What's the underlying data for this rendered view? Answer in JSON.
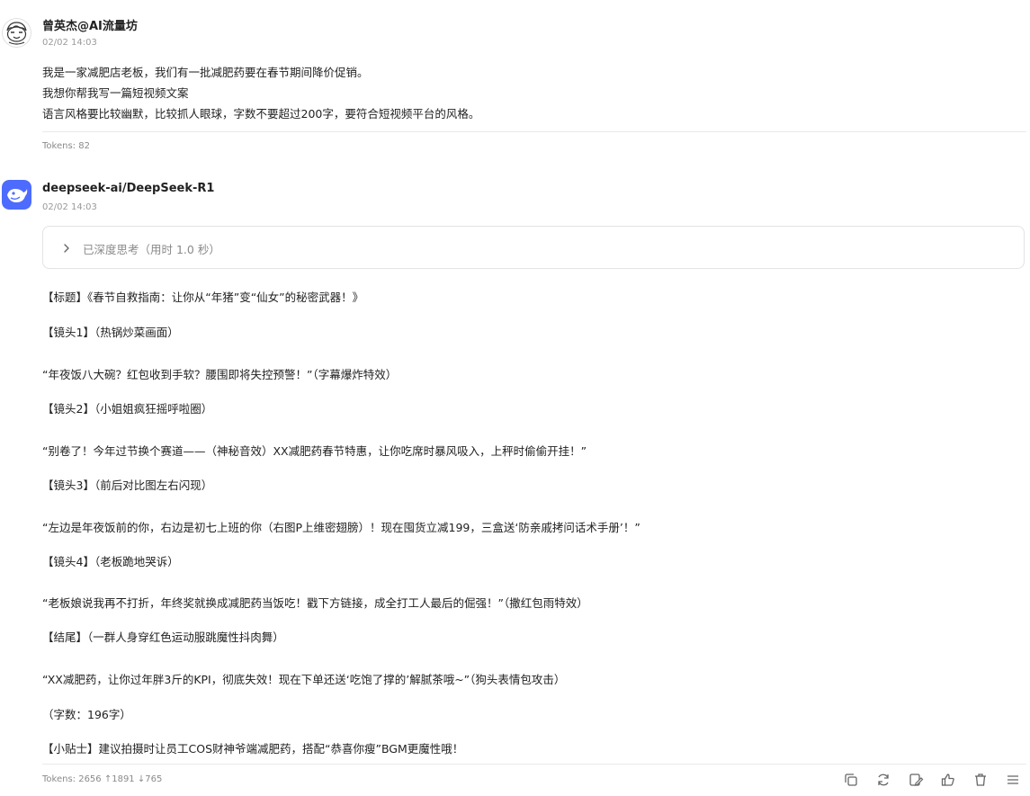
{
  "user_message": {
    "sender": "曾英杰@AI流量坊",
    "timestamp": "02/02 14:03",
    "lines": [
      "我是一家减肥店老板，我们有一批减肥药要在春节期间降价促销。",
      "我想你帮我写一篇短视频文案",
      "语言风格要比较幽默，比较抓人眼球，字数不要超过200字，要符合短视频平台的风格。"
    ],
    "tokens": "Tokens: 82"
  },
  "assistant_message": {
    "model": "deepseek-ai/DeepSeek-R1",
    "timestamp": "02/02 14:03",
    "thinking_label": "已深度思考（用时 1.0 秒）",
    "lines": [
      "【标题】《春节自救指南：让你从“年猪”变“仙女”的秘密武器！》",
      "【镜头1】（热锅炒菜画面）",
      "“年夜饭八大碗？红包收到手软？腰围即将失控预警！”（字幕爆炸特效）",
      "【镜头2】（小姐姐疯狂摇呼啦圈）",
      "“别卷了！今年过节换个赛道——（神秘音效）XX减肥药春节特惠，让你吃席时暴风吸入，上秤时偷偷开挂！”",
      "【镜头3】（前后对比图左右闪现）",
      "“左边是年夜饭前的你，右边是初七上班的你（右图P上维密翅膀）！现在囤货立减199，三盒送‘防亲戚拷问话术手册’！”",
      "【镜头4】（老板跪地哭诉）",
      "“老板娘说我再不打折，年终奖就换成减肥药当饭吃！戳下方链接，成全打工人最后的倔强！”（撒红包雨特效）",
      "【结尾】（一群人身穿红色运动服跳魔性抖肉舞）",
      "“XX减肥药，让你过年胖3斤的KPI，彻底失效！现在下单还送‘吃饱了撑的’解腻茶哦~”（狗头表情包攻击）",
      "（字数：196字）",
      "【小贴士】建议拍摄时让员工COS财神爷端减肥药，搭配“恭喜你瘦”BGM更魔性哦！"
    ],
    "tokens": "Tokens: 2656 ↑1891 ↓765"
  },
  "toolbar_icons": [
    "copy-icon",
    "regenerate-icon",
    "edit-icon",
    "like-icon",
    "delete-icon",
    "menu-icon"
  ],
  "colors": {
    "bot_avatar_bg": "#4d6bfe",
    "muted_text": "#8a8a8a"
  }
}
